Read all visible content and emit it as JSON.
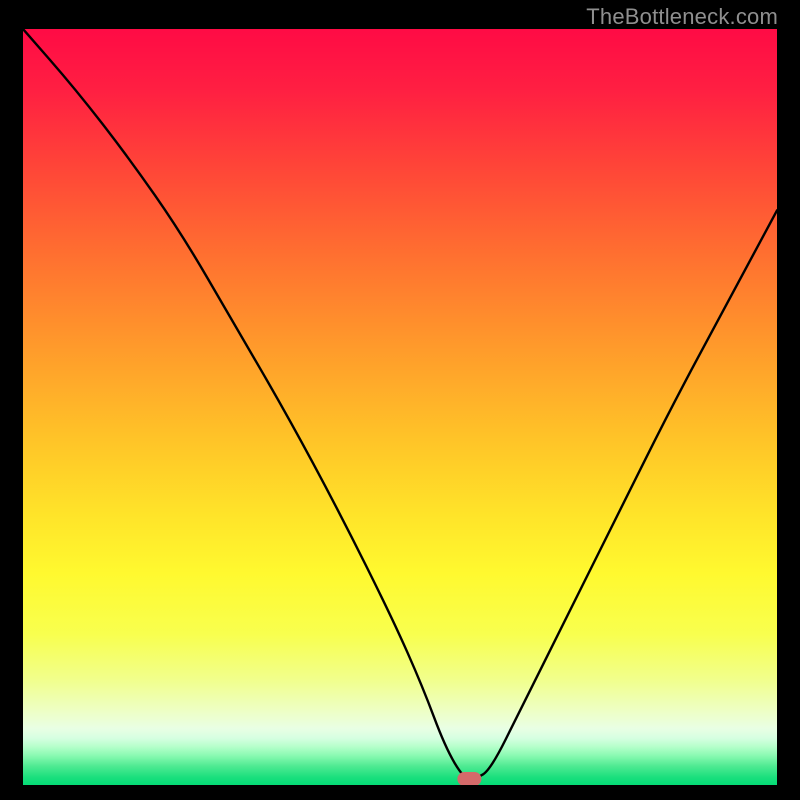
{
  "watermark": "TheBottleneck.com",
  "chart_data": {
    "type": "line",
    "title": "",
    "xlabel": "",
    "ylabel": "",
    "xlim": [
      0,
      100
    ],
    "ylim": [
      0,
      100
    ],
    "series": [
      {
        "name": "bottleneck-curve",
        "x": [
          0,
          7,
          14,
          21,
          28,
          35,
          42,
          49,
          53,
          56,
          58.5,
          60,
          62,
          66,
          72,
          79,
          86,
          93,
          100
        ],
        "values": [
          100,
          92,
          83,
          73,
          61,
          49,
          36,
          22,
          13,
          5,
          0.8,
          0.8,
          2,
          10,
          22,
          36,
          50,
          63,
          76
        ]
      }
    ],
    "marker": {
      "x": 59.2,
      "y": 0.8,
      "color": "#d46a6a"
    },
    "gradient_stops": [
      {
        "offset": 0.0,
        "color": "#ff0b45"
      },
      {
        "offset": 0.08,
        "color": "#ff1f42"
      },
      {
        "offset": 0.18,
        "color": "#ff4438"
      },
      {
        "offset": 0.3,
        "color": "#ff7030"
      },
      {
        "offset": 0.42,
        "color": "#ff9a2b"
      },
      {
        "offset": 0.54,
        "color": "#ffc328"
      },
      {
        "offset": 0.64,
        "color": "#ffe329"
      },
      {
        "offset": 0.72,
        "color": "#fff92f"
      },
      {
        "offset": 0.8,
        "color": "#f8ff4e"
      },
      {
        "offset": 0.86,
        "color": "#f1ff8b"
      },
      {
        "offset": 0.905,
        "color": "#edffc9"
      },
      {
        "offset": 0.925,
        "color": "#e9ffe4"
      },
      {
        "offset": 0.938,
        "color": "#d6ffe1"
      },
      {
        "offset": 0.95,
        "color": "#b3ffc9"
      },
      {
        "offset": 0.962,
        "color": "#86f9b0"
      },
      {
        "offset": 0.975,
        "color": "#4fea92"
      },
      {
        "offset": 0.99,
        "color": "#1adf7d"
      },
      {
        "offset": 1.0,
        "color": "#04dc76"
      }
    ]
  }
}
